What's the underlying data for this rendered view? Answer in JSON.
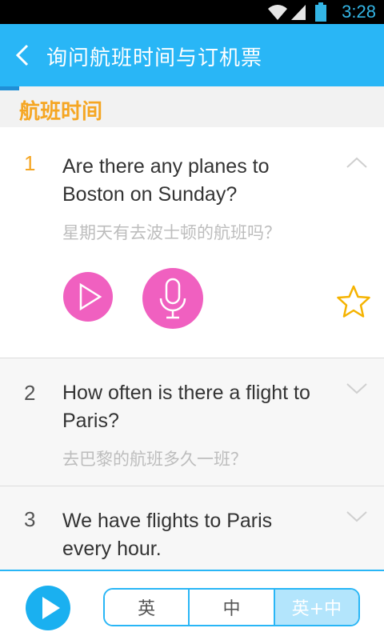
{
  "status_bar": {
    "time": "3:28"
  },
  "header": {
    "title": "询问航班时间与订机票",
    "back_icon": "back-chevron-icon"
  },
  "section": {
    "label": "航班时间"
  },
  "colors": {
    "accent": "#29b6f6",
    "number_active": "#f5a623",
    "action_pink": "#f060c0"
  },
  "items": [
    {
      "number": "1",
      "english": "Are there any planes to Boston on Sunday?",
      "chinese": "星期天有去波士顿的航班吗？",
      "expanded": true
    },
    {
      "number": "2",
      "english": "How often is there a flight to Paris?",
      "chinese": "去巴黎的航班多久一班？",
      "expanded": false
    },
    {
      "number": "3",
      "english": "We have flights to Paris every hour.",
      "chinese": "",
      "expanded": false
    }
  ],
  "bottom_bar": {
    "options": [
      "英",
      "中",
      "英+中"
    ],
    "selected": "英+中"
  }
}
